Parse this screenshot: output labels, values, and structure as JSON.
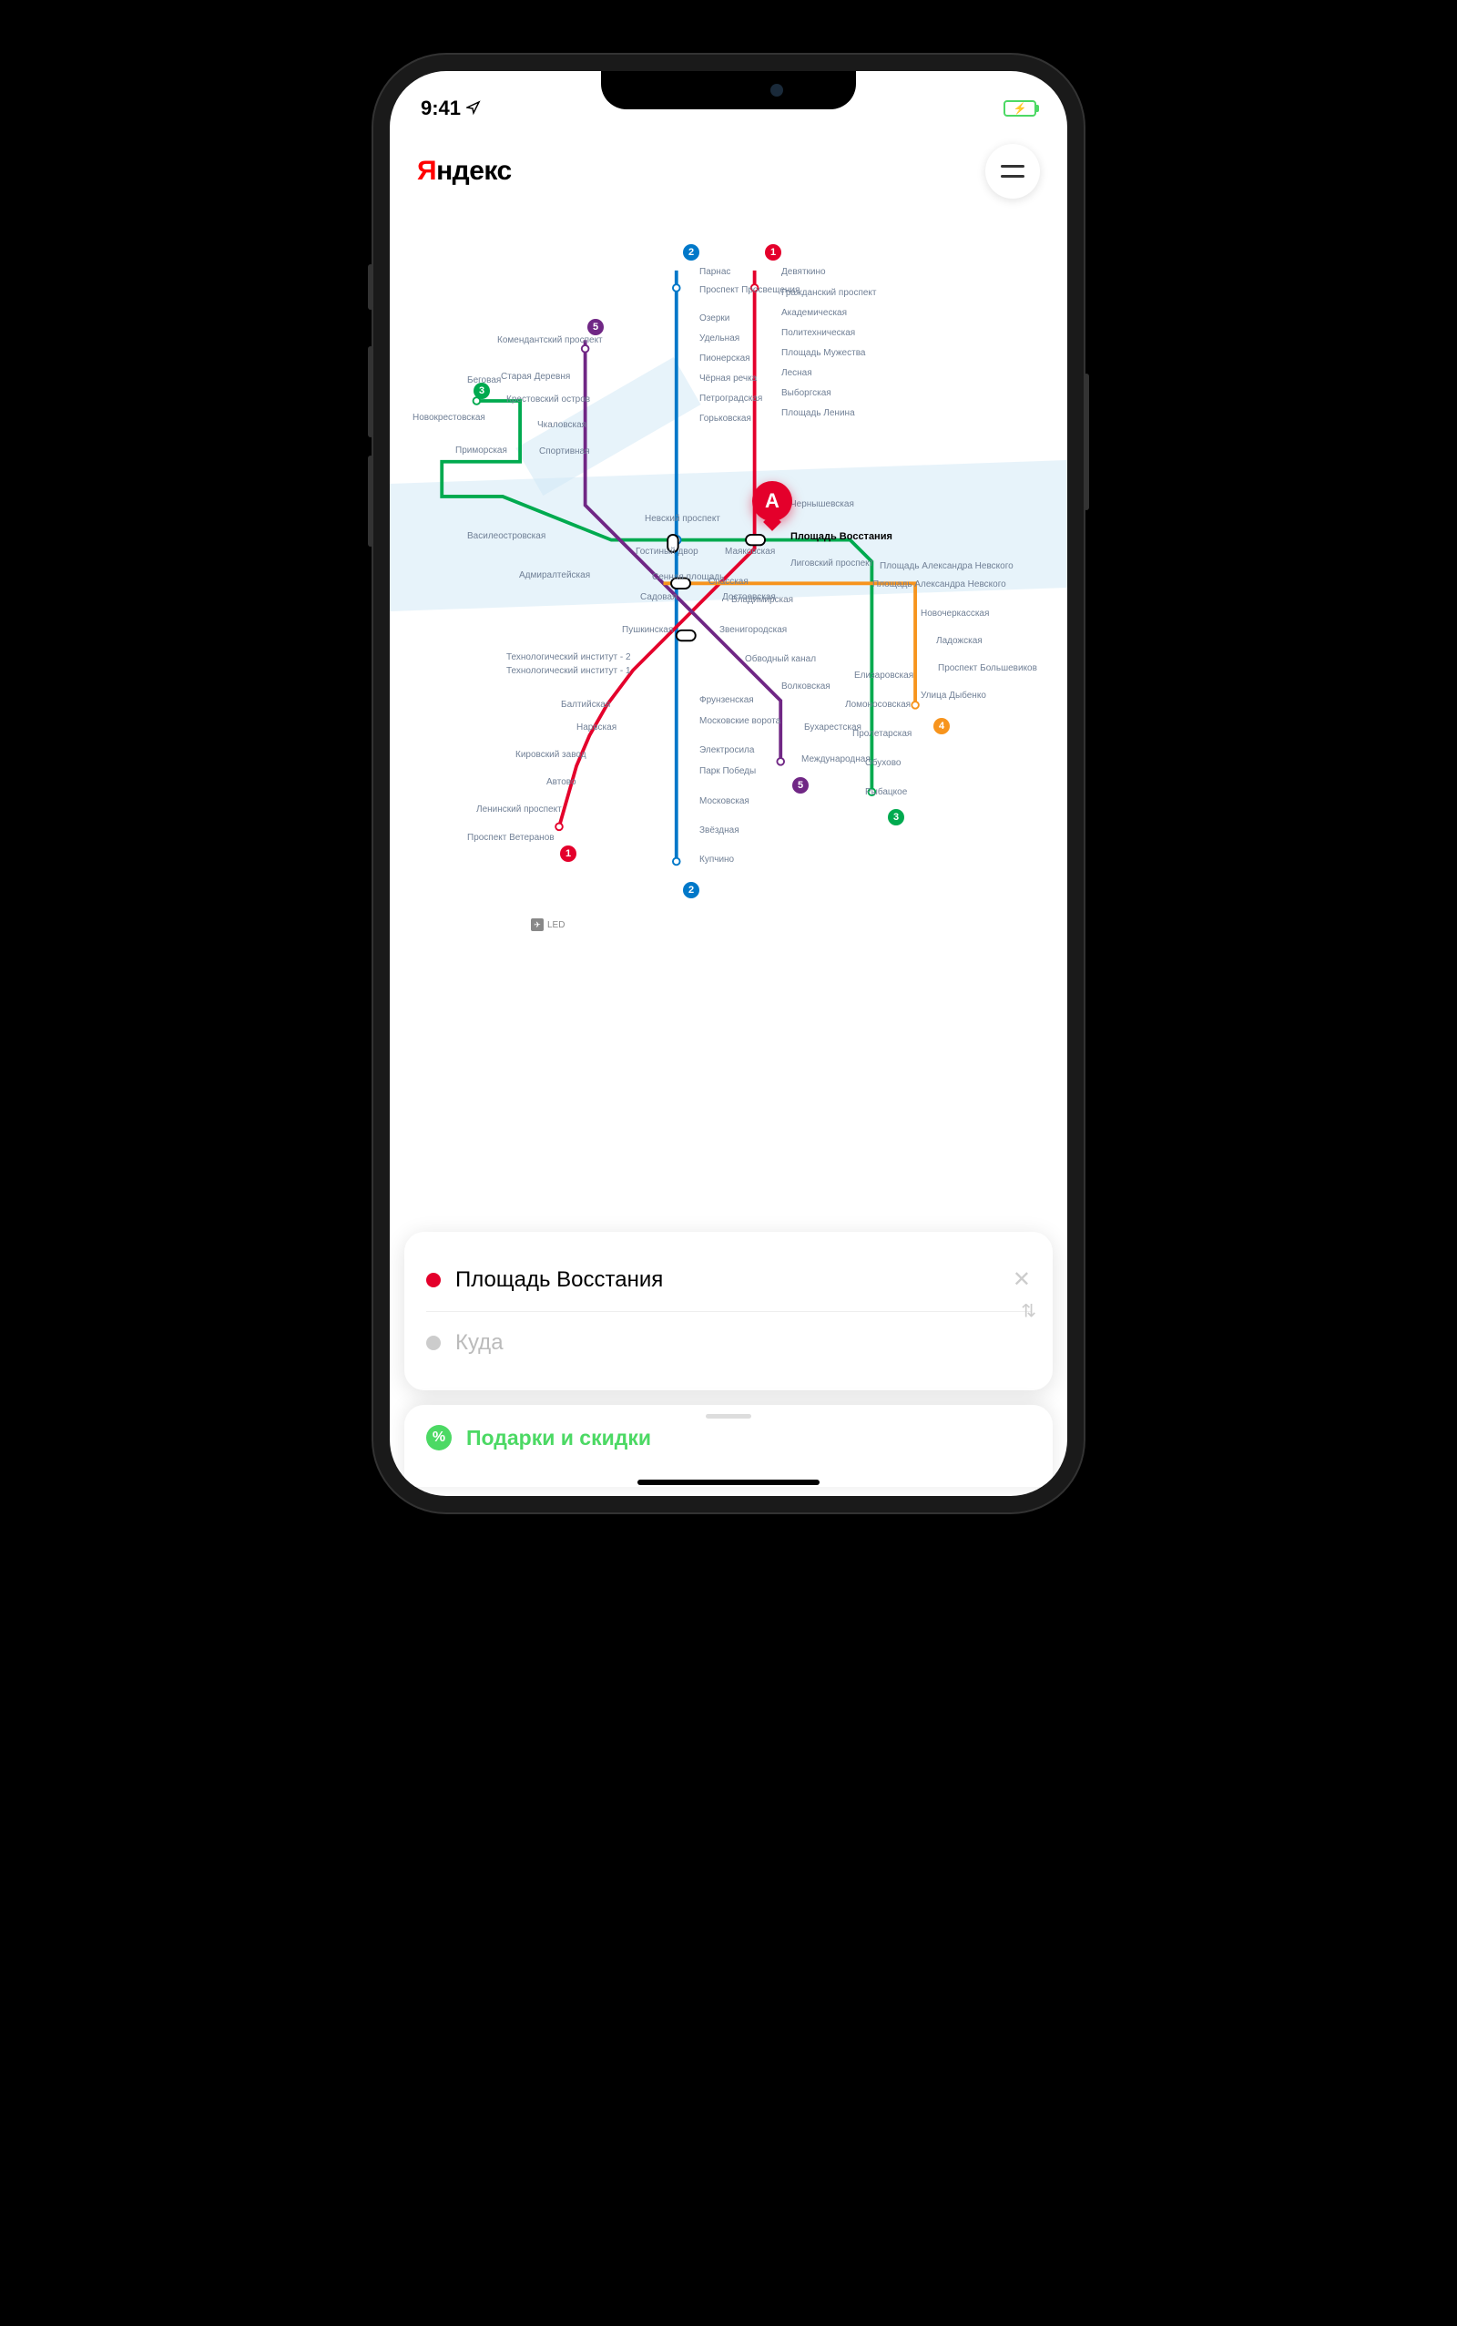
{
  "status": {
    "time": "9:41"
  },
  "header": {
    "logo_ya": "Я",
    "logo_rest": "ндекс"
  },
  "marker": {
    "label": "А"
  },
  "airport": {
    "code": "LED"
  },
  "route": {
    "from": "Площадь Восстания",
    "to_placeholder": "Куда"
  },
  "promo": {
    "text": "Подарки и скидки"
  },
  "lines": {
    "1": {
      "color": "#e4002b",
      "name": "Line 1"
    },
    "2": {
      "color": "#0078c9",
      "name": "Line 2"
    },
    "3": {
      "color": "#00aa4f",
      "name": "Line 3"
    },
    "4": {
      "color": "#f7941d",
      "name": "Line 4"
    },
    "5": {
      "color": "#702785",
      "name": "Line 5"
    }
  },
  "stations": {
    "l1": [
      "Девяткино",
      "Гражданский проспект",
      "Академическая",
      "Политехническая",
      "Площадь Мужества",
      "Лесная",
      "Выборгская",
      "Площадь Ленина",
      "Чернышевская",
      "Площадь Восстания",
      "Владимирская",
      "Пушкинская",
      "Технологический институт - 1",
      "Балтийская",
      "Нарвская",
      "Кировский завод",
      "Автово",
      "Ленинский проспект",
      "Проспект Ветеранов"
    ],
    "l2": [
      "Парнас",
      "Проспект Просвещения",
      "Озерки",
      "Удельная",
      "Пионерская",
      "Чёрная речка",
      "Петроградская",
      "Горьковская",
      "Невский проспект",
      "Сенная площадь",
      "Технологический институт - 2",
      "Фрунзенская",
      "Московские ворота",
      "Электросила",
      "Парк Победы",
      "Московская",
      "Звёздная",
      "Купчино"
    ],
    "l3": [
      "Беговая",
      "Новокрестовская",
      "Приморская",
      "Василеостровская",
      "Гостиный двор",
      "Маяковская",
      "Площадь Александра Невского",
      "Елизаровская",
      "Ломоносовская",
      "Пролетарская",
      "Обухово",
      "Рыбацкое"
    ],
    "l4": [
      "Спасская",
      "Достоевская",
      "Лиговский проспект",
      "Площадь Александра Невского",
      "Новочеркасская",
      "Ладожская",
      "Проспект Большевиков",
      "Улица Дыбенко"
    ],
    "l5": [
      "Комендантский проспект",
      "Старая Деревня",
      "Крестовский остров",
      "Чкаловская",
      "Спортивная",
      "Адмиралтейская",
      "Садовая",
      "Звенигородская",
      "Обводный канал",
      "Волковская",
      "Бухарестская",
      "Международная"
    ]
  }
}
